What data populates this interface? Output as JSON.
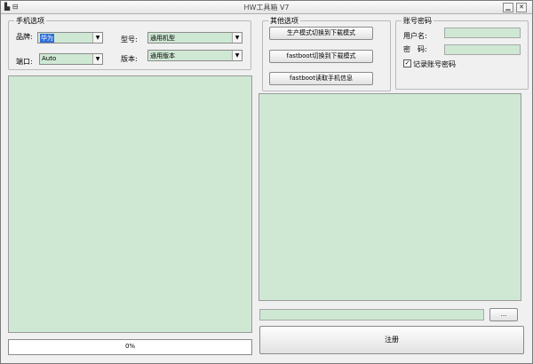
{
  "window": {
    "title": "HW工具箱 V7",
    "icon": "app-icon-glyph"
  },
  "phone_options": {
    "legend": "手机选项",
    "brand_label": "品牌:",
    "brand_value": "华为",
    "model_label": "型号:",
    "model_value": "通用机型",
    "port_label": "端口:",
    "port_value": "Auto",
    "version_label": "版本:",
    "version_value": "通用版本"
  },
  "other_options": {
    "legend": "其他选项",
    "btn_production": "生产模式切换到下载模式",
    "btn_fastboot_download": "fastboot切换到下载模式",
    "btn_fastboot_info": "fastboot读取手机信息"
  },
  "account": {
    "legend": "账号密码",
    "username_label": "用户名:",
    "password_label": "密　码:",
    "remember_label": "记录账号密码",
    "remember_checked": true
  },
  "progress": {
    "text": "0%",
    "value": 0
  },
  "file": {
    "browse_label": "..."
  },
  "register_label": "注册",
  "colors": {
    "field_bg": "#cfe8d4",
    "window_bg": "#f0f0f0"
  }
}
